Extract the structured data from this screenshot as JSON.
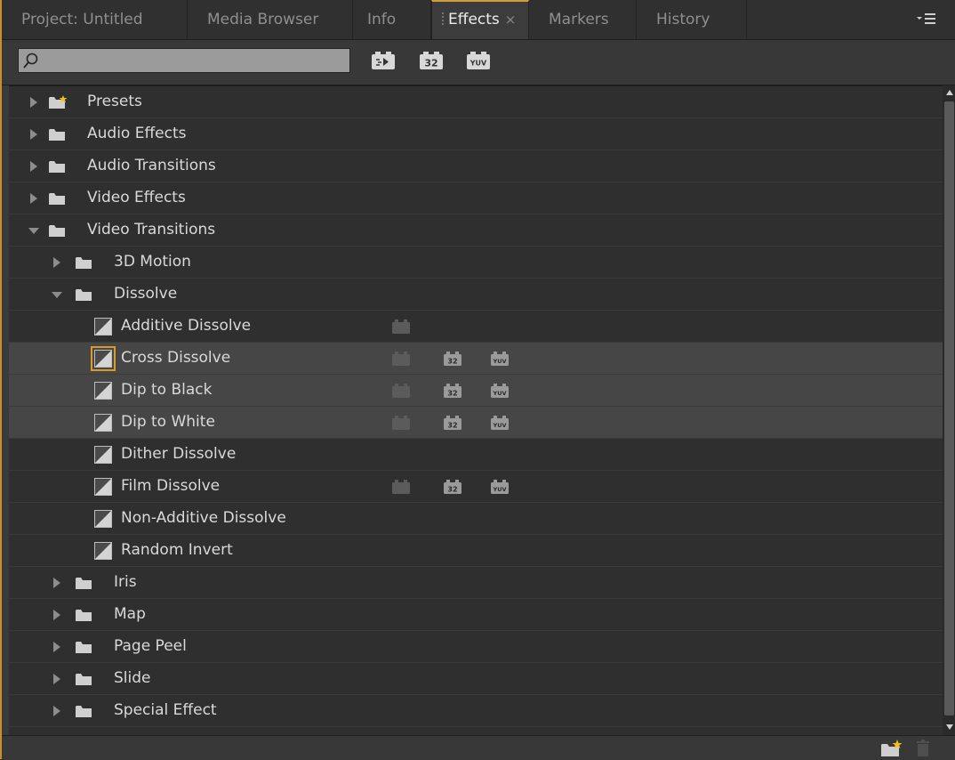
{
  "colors": {
    "accent": "#d49d34",
    "folder": "#cfcfcf",
    "preset_star": "#f2c01e",
    "background": "#2f2f2f"
  },
  "tabs": [
    {
      "label": "Project: Untitled",
      "active": false
    },
    {
      "label": "Media Browser",
      "active": false
    },
    {
      "label": "Info",
      "active": false
    },
    {
      "label": "Effects",
      "active": true,
      "close": "×"
    },
    {
      "label": "Markers",
      "active": false
    },
    {
      "label": "History",
      "active": false
    }
  ],
  "panel_menu_icon": "panel-menu-icon",
  "search": {
    "value": "",
    "placeholder": ""
  },
  "toolbar_filters": [
    {
      "name": "accelerated-effects-filter",
      "text": "⇄▶"
    },
    {
      "name": "32bit-color-filter",
      "text": "32"
    },
    {
      "name": "yuv-filter",
      "text": "YUV"
    }
  ],
  "tree": [
    {
      "label": "Presets",
      "type": "folder",
      "level": 0,
      "expanded": false,
      "star": true
    },
    {
      "label": "Audio Effects",
      "type": "folder",
      "level": 0,
      "expanded": false
    },
    {
      "label": "Audio Transitions",
      "type": "folder",
      "level": 0,
      "expanded": false
    },
    {
      "label": "Video Effects",
      "type": "folder",
      "level": 0,
      "expanded": false
    },
    {
      "label": "Video Transitions",
      "type": "folder",
      "level": 0,
      "expanded": true
    },
    {
      "label": "3D Motion",
      "type": "folder",
      "level": 1,
      "expanded": false
    },
    {
      "label": "Dissolve",
      "type": "folder",
      "level": 1,
      "expanded": true
    },
    {
      "label": "Additive Dissolve",
      "type": "effect",
      "level": 2,
      "badges": [
        "accelerated"
      ]
    },
    {
      "label": "Cross Dissolve",
      "type": "effect",
      "level": 2,
      "selected": true,
      "highlight": true,
      "badges": [
        "accelerated",
        "32",
        "yuv"
      ]
    },
    {
      "label": "Dip to Black",
      "type": "effect",
      "level": 2,
      "highlight": true,
      "badges": [
        "accelerated",
        "32",
        "yuv"
      ]
    },
    {
      "label": "Dip to White",
      "type": "effect",
      "level": 2,
      "highlight": true,
      "badges": [
        "accelerated",
        "32",
        "yuv"
      ]
    },
    {
      "label": "Dither Dissolve",
      "type": "effect",
      "level": 2,
      "badges": []
    },
    {
      "label": "Film Dissolve",
      "type": "effect",
      "level": 2,
      "badges": [
        "accelerated",
        "32",
        "yuv"
      ]
    },
    {
      "label": "Non-Additive Dissolve",
      "type": "effect",
      "level": 2,
      "badges": []
    },
    {
      "label": "Random Invert",
      "type": "effect",
      "level": 2,
      "badges": []
    },
    {
      "label": "Iris",
      "type": "folder",
      "level": 1,
      "expanded": false
    },
    {
      "label": "Map",
      "type": "folder",
      "level": 1,
      "expanded": false
    },
    {
      "label": "Page Peel",
      "type": "folder",
      "level": 1,
      "expanded": false
    },
    {
      "label": "Slide",
      "type": "folder",
      "level": 1,
      "expanded": false
    },
    {
      "label": "Special Effect",
      "type": "folder",
      "level": 1,
      "expanded": false
    }
  ],
  "badge_text": {
    "32": "32",
    "yuv": "YUV"
  },
  "footer": {
    "new_bin_icon": "new-custom-bin-icon",
    "delete_icon": "trash-icon"
  }
}
